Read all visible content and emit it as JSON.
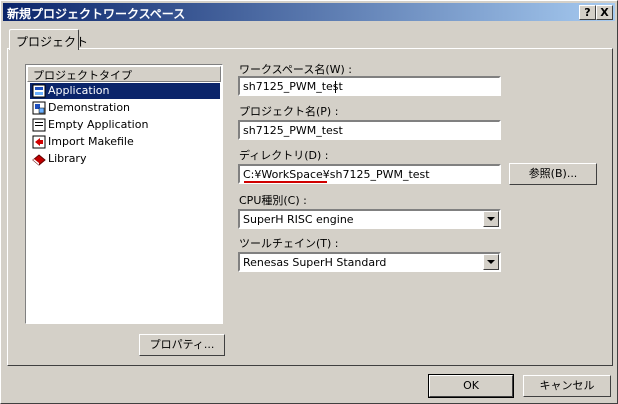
{
  "window": {
    "title": "新規プロジェクトワークスペース",
    "help_button": "?",
    "close_button": "X"
  },
  "tab": {
    "label": "プロジェクト"
  },
  "project_types": {
    "header": "プロジェクトタイプ",
    "items": [
      {
        "label": "Application",
        "icon": "application-icon",
        "selected": true
      },
      {
        "label": "Demonstration",
        "icon": "demonstration-icon",
        "selected": false
      },
      {
        "label": "Empty Application",
        "icon": "empty-application-icon",
        "selected": false
      },
      {
        "label": "Import Makefile",
        "icon": "import-makefile-icon",
        "selected": false
      },
      {
        "label": "Library",
        "icon": "library-icon",
        "selected": false
      }
    ],
    "properties_button": "プロパティ..."
  },
  "workspace_name": {
    "label": "ワークスペース名(W) :",
    "value": "sh7125_PWM_test"
  },
  "project_name": {
    "label": "プロジェクト名(P) :",
    "value": "sh7125_PWM_test"
  },
  "directory": {
    "label": "ディレクトリ(D) :",
    "value": "C:¥WorkSpace¥sh7125_PWM_test",
    "browse_button": "参照(B)..."
  },
  "cpu_type": {
    "label": "CPU種別(C) :",
    "value": "SuperH RISC engine"
  },
  "toolchain": {
    "label": "ツールチェイン(T) :",
    "value": "Renesas SuperH Standard"
  },
  "footer": {
    "ok_button": "OK",
    "cancel_button": "キャンセル"
  },
  "colors": {
    "selection": "#0a246a",
    "annotation_underline": "#d00000",
    "dialog_face": "#d4d0c8"
  }
}
